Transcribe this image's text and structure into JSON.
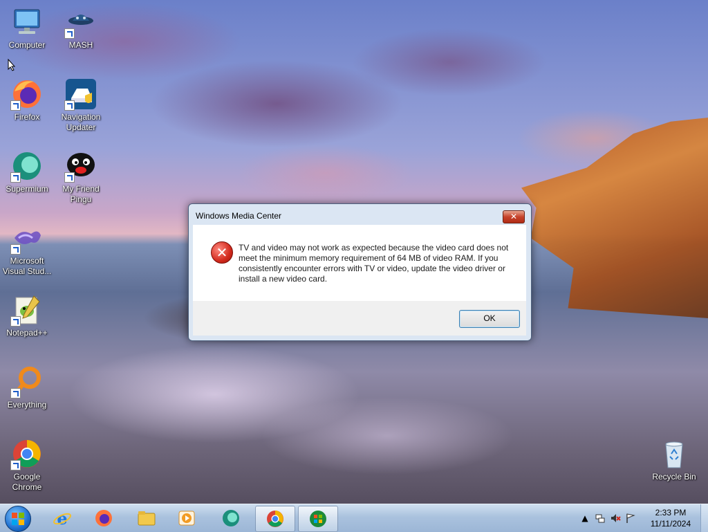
{
  "desktop": {
    "icons": [
      {
        "label": "Computer"
      },
      {
        "label": "MASH"
      },
      {
        "label": "Firefox"
      },
      {
        "label": "Navigation Updater"
      },
      {
        "label": "Supermium"
      },
      {
        "label": "My Friend Pingu"
      },
      {
        "label": "Microsoft Visual Stud..."
      },
      {
        "label": "Notepad++"
      },
      {
        "label": "Everything"
      },
      {
        "label": "Google Chrome"
      },
      {
        "label": "Recycle Bin"
      }
    ]
  },
  "dialog": {
    "title": "Windows Media Center",
    "close_label": "✕",
    "message": "TV and video may not work as expected because the video card does not meet the minimum memory requirement of 64 MB of video RAM. If you consistently encounter errors with TV or video, update the video driver or install a new video card.",
    "icon": "error-icon",
    "ok_label": "OK"
  },
  "taskbar": {
    "pinned": [
      {
        "name": "internet-explorer-icon"
      },
      {
        "name": "firefox-icon"
      },
      {
        "name": "file-explorer-icon"
      },
      {
        "name": "media-player-icon"
      },
      {
        "name": "supermium-icon"
      },
      {
        "name": "chrome-icon",
        "active": true
      },
      {
        "name": "windows-media-center-icon",
        "active": true
      }
    ],
    "tray": {
      "show_hidden_label": "▲",
      "time": "2:33 PM",
      "date": "11/11/2024"
    }
  },
  "colors": {
    "accent": "#1d6fcf",
    "error": "#d22a1d",
    "close_button": "#c6432b"
  }
}
